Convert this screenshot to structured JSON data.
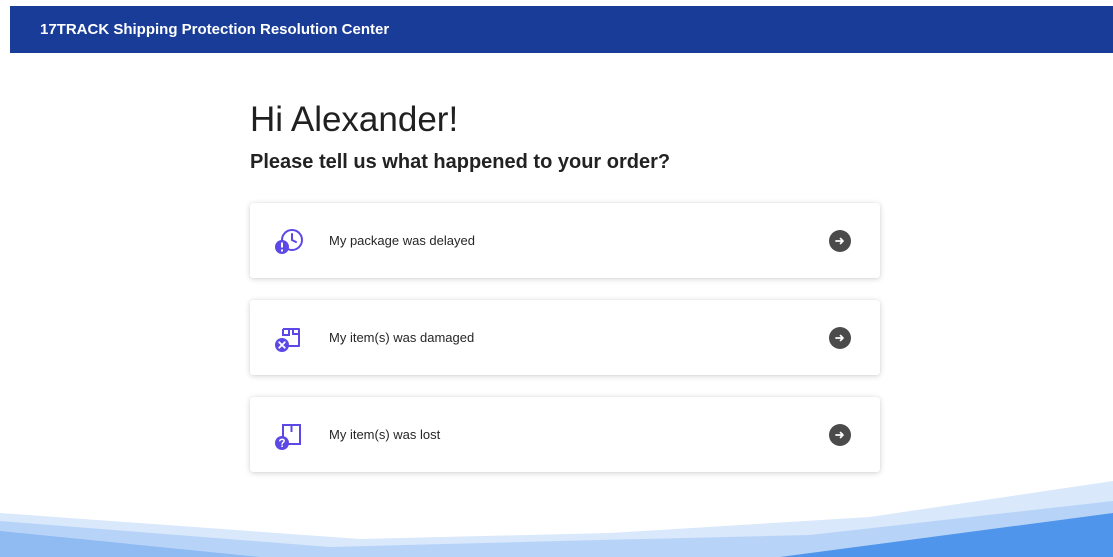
{
  "header": {
    "title": "17TRACK Shipping Protection Resolution Center"
  },
  "main": {
    "greeting": "Hi Alexander!",
    "question": "Please tell us what happened to your order?",
    "options": [
      {
        "label": "My package was delayed",
        "icon": "delayed-package-icon"
      },
      {
        "label": "My item(s) was damaged",
        "icon": "damaged-item-icon"
      },
      {
        "label": "My item(s) was lost",
        "icon": "lost-item-icon"
      }
    ]
  },
  "colors": {
    "header_bg": "#183c98",
    "accent_purple": "#5b48e6",
    "arrow_bg": "#4b4b4b",
    "wave_light": "#d9e8fb",
    "wave_mid": "#9fc4f6",
    "wave_dark": "#4f95eb"
  }
}
